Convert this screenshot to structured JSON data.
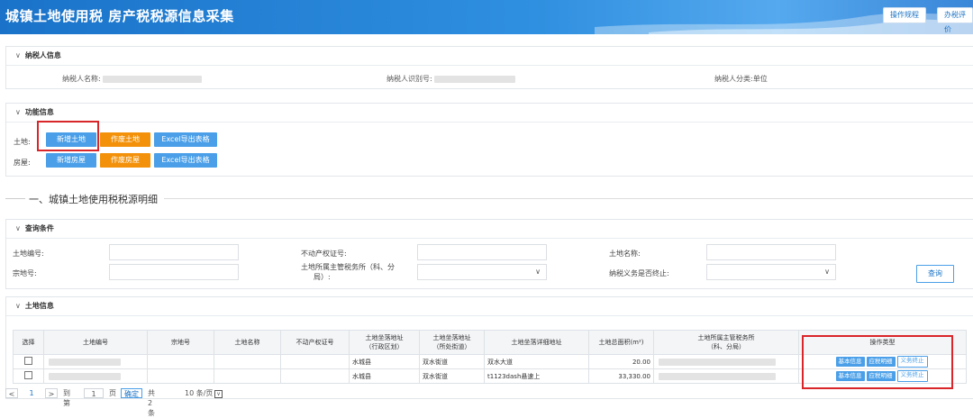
{
  "header": {
    "title": "城镇土地使用税 房产税税源信息采集",
    "buttons": [
      "操作规程",
      "办税评价"
    ]
  },
  "taxpayer": {
    "section_title": "纳税人信息",
    "name_label": "纳税人名称:",
    "id_label": "纳税人识别号:",
    "category_label": "纳税人分类:",
    "category_value": "单位"
  },
  "functions": {
    "section_title": "功能信息",
    "land_label": "土地:",
    "house_label": "房屋:",
    "add_land": "新增土地",
    "void_land": "作废土地",
    "export_land": "Excel导出表格",
    "add_house": "新增房屋",
    "void_house": "作废房屋",
    "export_house": "Excel导出表格"
  },
  "section": {
    "title": "一、城镇土地使用税税源明细"
  },
  "query": {
    "section_title": "查询条件",
    "land_no_label": "土地编号:",
    "property_cert_label": "不动产权证号:",
    "land_name_label": "土地名称:",
    "parcel_no_label": "宗地号:",
    "tax_office_label_1": "土地所属主管税务所（科、分",
    "tax_office_label_2": "局）:",
    "terminated_label": "纳税义务是否终止:",
    "search_button": "查询"
  },
  "land_info": {
    "section_title": "土地信息",
    "columns": {
      "select": "选择",
      "land_no": "土地编号",
      "parcel_no": "宗地号",
      "land_name": "土地名称",
      "property_cert": "不动产权证号",
      "district_1": "土地坐落地址",
      "district_2": "（行政区划）",
      "street_1": "土地坐落地址",
      "street_2": "（所处街道）",
      "address": "土地坐落详细地址",
      "area": "土地总面积(m²)",
      "office_1": "土地所属主管税务所",
      "office_2": "（科、分局）",
      "ops": "操作类型"
    },
    "rows": [
      {
        "district": "水城县",
        "street": "双水街道",
        "address": "双水大道",
        "area": "20.00"
      },
      {
        "district": "水城县",
        "street": "双水街道",
        "address": "t1123dash悬速上",
        "area": "33,330.00"
      }
    ],
    "row_actions": [
      "基本信息",
      "应税明细",
      "义务终止"
    ]
  },
  "pager": {
    "prev": "<",
    "current": "1",
    "next": ">",
    "goto_label": "到第",
    "goto_value": "1",
    "page_unit": "页",
    "confirm": "确定",
    "total": "共 2 条",
    "page_size": "10 条/页"
  },
  "colors": {
    "accent": "#4a9fe8",
    "warning": "#f3920a",
    "highlight": "#d9262a"
  }
}
